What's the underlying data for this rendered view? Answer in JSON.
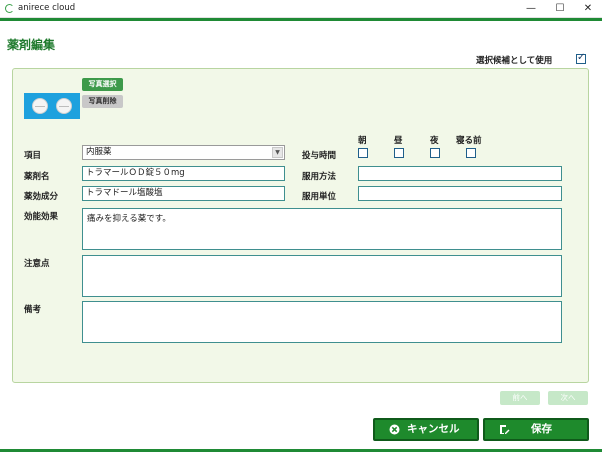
{
  "window": {
    "app_title": "anirece cloud",
    "minimize": "—",
    "maximize": "☐",
    "close": "✕"
  },
  "page": {
    "title": "薬剤編集"
  },
  "candidate": {
    "label": "選択候補として使用",
    "checked": true
  },
  "photo": {
    "select_label": "写真選択",
    "delete_label": "写真削除"
  },
  "form": {
    "category": {
      "label": "項目",
      "value": "内服薬"
    },
    "drug_name": {
      "label": "薬剤名",
      "value": "トラマールＯＤ錠５０mg"
    },
    "ingredient": {
      "label": "薬効成分",
      "value": "トラマドール塩酸塩"
    },
    "efficacy": {
      "label": "効能効果",
      "value": "痛みを抑える薬です。"
    },
    "caution": {
      "label": "注意点",
      "value": ""
    },
    "remarks": {
      "label": "備考",
      "value": ""
    },
    "dosage_time": {
      "label": "投与時間",
      "times": [
        {
          "label": "朝",
          "checked": false
        },
        {
          "label": "昼",
          "checked": false
        },
        {
          "label": "夜",
          "checked": false
        },
        {
          "label": "寝る前",
          "checked": false
        }
      ]
    },
    "usage_method": {
      "label": "服用方法",
      "value": ""
    },
    "usage_unit": {
      "label": "服用単位",
      "value": ""
    }
  },
  "nav": {
    "prev_label": "前へ",
    "next_label": "次へ"
  },
  "actions": {
    "cancel_label": "キャンセル",
    "save_label": "保存"
  },
  "colors": {
    "accent": "#1f8a35",
    "title_green": "#1e7a2c",
    "panel_bg": "#f2f8e8",
    "photo_bg": "#1ea1de"
  }
}
